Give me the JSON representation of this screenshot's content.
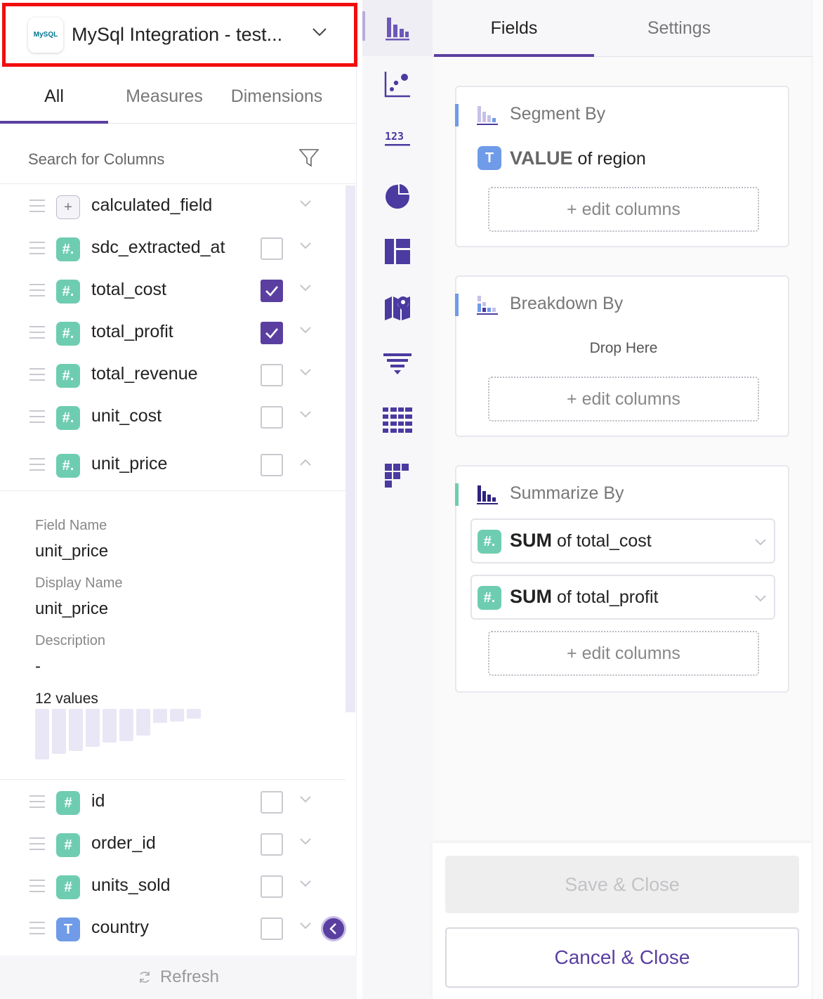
{
  "source": {
    "title": "MySql Integration - test...",
    "logo_text": "MySQL"
  },
  "left_tabs": [
    {
      "label": "All",
      "active": true
    },
    {
      "label": "Measures",
      "active": false
    },
    {
      "label": "Dimensions",
      "active": false
    }
  ],
  "search": {
    "placeholder": "Search for Columns"
  },
  "columns_top": [
    {
      "name": "calculated_field",
      "type": "calc",
      "checkbox": false
    },
    {
      "name": "sdc_extracted_at",
      "type": "num",
      "checkbox": true,
      "checked": false
    },
    {
      "name": "total_cost",
      "type": "num",
      "checkbox": true,
      "checked": true
    },
    {
      "name": "total_profit",
      "type": "num",
      "checkbox": true,
      "checked": true
    },
    {
      "name": "total_revenue",
      "type": "num",
      "checkbox": true,
      "checked": false
    },
    {
      "name": "unit_cost",
      "type": "num",
      "checkbox": true,
      "checked": false
    },
    {
      "name": "unit_price",
      "type": "num",
      "checkbox": true,
      "checked": false,
      "expanded": true
    }
  ],
  "detail": {
    "field_name_label": "Field Name",
    "field_name": "unit_price",
    "display_name_label": "Display Name",
    "display_name": "unit_price",
    "description_label": "Description",
    "description": "-",
    "values_count": "12 values"
  },
  "columns_bottom": [
    {
      "name": "id",
      "type": "num",
      "checked": false
    },
    {
      "name": "order_id",
      "type": "num",
      "checked": false
    },
    {
      "name": "units_sold",
      "type": "num",
      "checked": false
    },
    {
      "name": "country",
      "type": "txt",
      "checked": false
    }
  ],
  "refresh_label": "Refresh",
  "chart_types": [
    "bar-chart-icon",
    "scatter-chart-icon",
    "number-kpi-icon",
    "pie-chart-icon",
    "treemap-icon",
    "map-icon",
    "funnel-icon",
    "table-icon",
    "heatmap-icon"
  ],
  "right_tabs": [
    {
      "label": "Fields",
      "active": true
    },
    {
      "label": "Settings",
      "active": false
    }
  ],
  "segment": {
    "title": "Segment By",
    "item_bold": "VALUE",
    "item_rest": " of region",
    "edit_label": "+ edit columns"
  },
  "breakdown": {
    "title": "Breakdown By",
    "drop_label": "Drop Here",
    "edit_label": "+ edit columns"
  },
  "summarize": {
    "title": "Summarize By",
    "items": [
      {
        "bold": "SUM",
        "rest": " of total_cost"
      },
      {
        "bold": "SUM",
        "rest": " of total_profit"
      }
    ],
    "edit_label": "+ edit columns"
  },
  "footer": {
    "save_label": "Save & Close",
    "cancel_label": "Cancel & Close"
  },
  "colors": {
    "accent": "#5a3fa0",
    "number_type": "#6ecdb0",
    "text_type": "#6f9be8",
    "highlight": "#f20d0d"
  }
}
